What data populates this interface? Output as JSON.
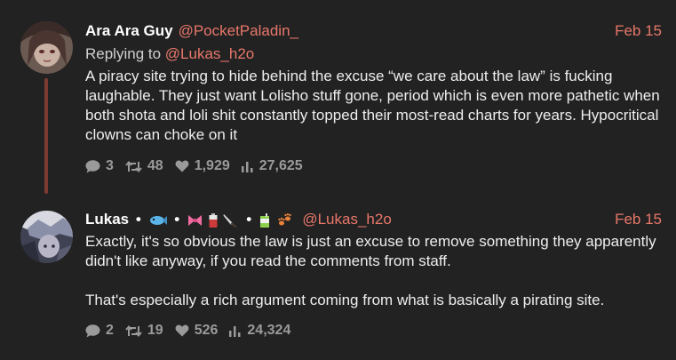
{
  "posts": [
    {
      "display_name": "Ara Ara Guy",
      "handle": "@PocketPaladin_",
      "date": "Feb 15",
      "reply_prefix": "Replying to",
      "reply_to": "@Lukas_h2o",
      "paragraphs": [
        "A piracy site trying to hide behind the excuse “we care about the law” is fucking laughable. They just want Lolisho stuff gone, period which is even more pathetic when both shota and loli shit constantly topped their most-read charts for years. Hypocritical clowns can choke on it"
      ],
      "stats": {
        "replies": "3",
        "reposts": "48",
        "likes": "1,929",
        "views": "27,625"
      }
    },
    {
      "display_name": "Lukas",
      "handle": "@Lukas_h2o",
      "date": "Feb 15",
      "name_badges": [
        "fish-emoji",
        "ribbon-emoji",
        "battery-emoji",
        "knife-emoji",
        "juice-box-emoji",
        "paw-prints-emoji"
      ],
      "paragraphs": [
        "Exactly, it's so obvious the law is just an excuse to remove something they apparently didn't like anyway, if you read the comments from staff.",
        "That's especially a rich argument coming from what is basically a pirating site."
      ],
      "stats": {
        "replies": "2",
        "reposts": "19",
        "likes": "526",
        "views": "24,324"
      }
    }
  ],
  "colors": {
    "background": "#222222",
    "accent": "#e8776a",
    "thread_line": "#7d3a33",
    "muted": "#9a9a9a"
  }
}
